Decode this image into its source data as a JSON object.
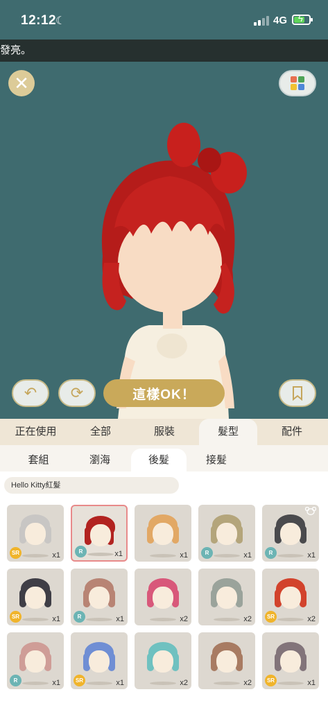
{
  "status_bar": {
    "time": "12:12",
    "network": "4G"
  },
  "banner": {
    "text": "發亮。"
  },
  "stage": {
    "confirm_label": "這樣OK！"
  },
  "main_tabs": [
    {
      "label": "正在使用"
    },
    {
      "label": "全部"
    },
    {
      "label": "服裝"
    },
    {
      "label": "髮型"
    },
    {
      "label": "配件"
    }
  ],
  "sub_tabs": [
    {
      "label": "套組"
    },
    {
      "label": "瀏海"
    },
    {
      "label": "後髮"
    },
    {
      "label": "接髮"
    }
  ],
  "selected_item_name": "Hello Kitty紅髮",
  "items": [
    {
      "rarity": "SR",
      "qty": "x1",
      "hair": "#c8c6c4"
    },
    {
      "rarity": "R",
      "qty": "x1",
      "hair": "#b22320"
    },
    {
      "rarity": "",
      "qty": "x1",
      "hair": "#e2a865"
    },
    {
      "rarity": "R",
      "qty": "x1",
      "hair": "#b4a57b"
    },
    {
      "rarity": "R",
      "qty": "x1",
      "hair": "#4a4a4d"
    },
    {
      "rarity": "SR",
      "qty": "x1",
      "hair": "#3f3e46"
    },
    {
      "rarity": "R",
      "qty": "x1",
      "hair": "#b88474"
    },
    {
      "rarity": "",
      "qty": "x2",
      "hair": "#d8587a"
    },
    {
      "rarity": "",
      "qty": "x2",
      "hair": "#9aa39b"
    },
    {
      "rarity": "SR",
      "qty": "x2",
      "hair": "#d2432c"
    },
    {
      "rarity": "R",
      "qty": "x1",
      "hair": "#cf9d97"
    },
    {
      "rarity": "SR",
      "qty": "x1",
      "hair": "#6f8ed4"
    },
    {
      "rarity": "",
      "qty": "x2",
      "hair": "#6fc1c0"
    },
    {
      "rarity": "",
      "qty": "x2",
      "hair": "#a87b62"
    },
    {
      "rarity": "SR",
      "qty": "x1",
      "hair": "#82747a"
    }
  ]
}
